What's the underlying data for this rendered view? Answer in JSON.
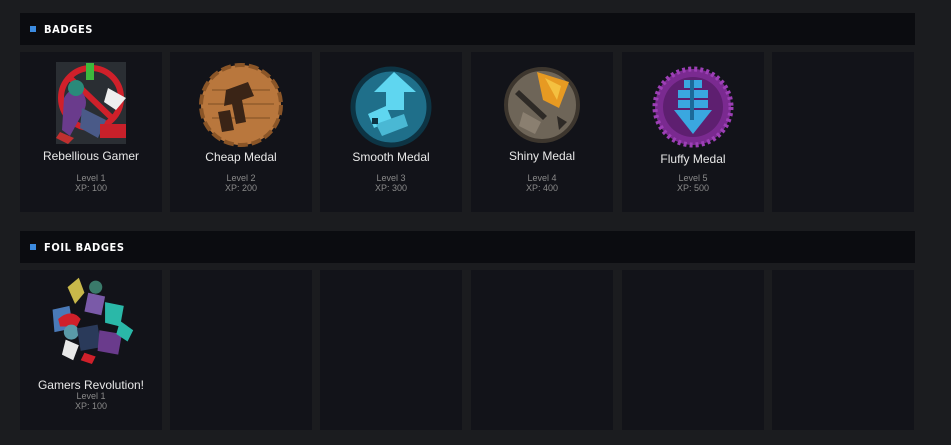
{
  "badges": {
    "header": "BADGES",
    "items": [
      {
        "name": "Rebellious Gamer",
        "level": "Level 1",
        "xp": "XP: 100",
        "icon": "rebellious-gamer-badge"
      },
      {
        "name": "Cheap Medal",
        "level": "Level 2",
        "xp": "XP: 200",
        "icon": "cheap-medal-badge"
      },
      {
        "name": "Smooth Medal",
        "level": "Level 3",
        "xp": "XP: 300",
        "icon": "smooth-medal-badge"
      },
      {
        "name": "Shiny Medal",
        "level": "Level 4",
        "xp": "XP: 400",
        "icon": "shiny-medal-badge"
      },
      {
        "name": "Fluffy Medal",
        "level": "Level 5",
        "xp": "XP: 500",
        "icon": "fluffy-medal-badge"
      }
    ]
  },
  "foil_badges": {
    "header": "FOIL BADGES",
    "items": [
      {
        "name": "Gamers Revolution!",
        "level": "Level 1",
        "xp": "XP: 100",
        "icon": "gamers-revolution-badge"
      }
    ]
  },
  "colors": {
    "background": "#1b1c1f",
    "card": "#121319",
    "header": "#0b0c10",
    "accent": "#3c8be0"
  }
}
